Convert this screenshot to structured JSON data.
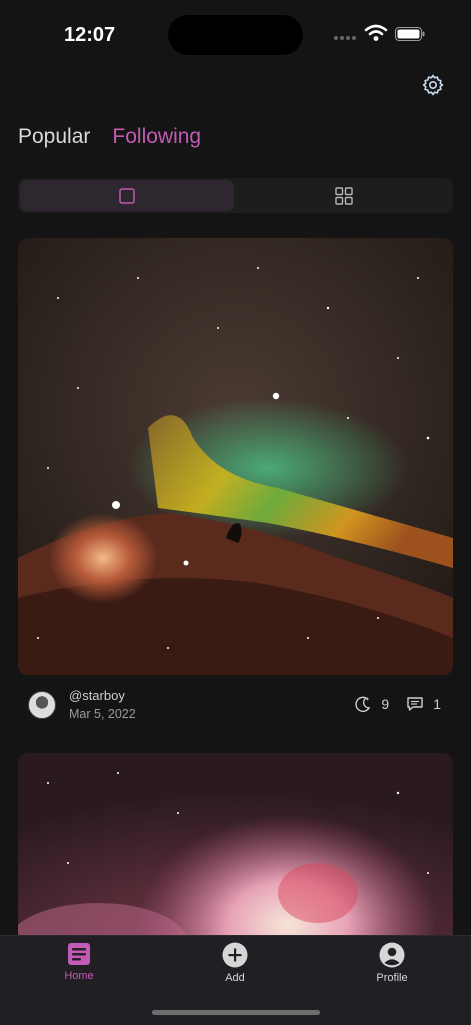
{
  "status_bar": {
    "time": "12:07"
  },
  "header": {
    "settings_icon": "gear-icon"
  },
  "tabs": [
    {
      "label": "Popular",
      "active": false
    },
    {
      "label": "Following",
      "active": true
    }
  ],
  "view_toggle": {
    "options": [
      "single-view-icon",
      "grid-view-icon"
    ],
    "selected": "single-view-icon"
  },
  "feed": {
    "posts": [
      {
        "author": "@starboy",
        "date": "Mar 5, 2022",
        "likes": "9",
        "comments": "1"
      }
    ]
  },
  "bottom_nav": {
    "items": [
      {
        "label": "Home",
        "icon": "home-icon",
        "active": true
      },
      {
        "label": "Add",
        "icon": "add-icon",
        "active": false
      },
      {
        "label": "Profile",
        "icon": "profile-icon",
        "active": false
      }
    ]
  },
  "colors": {
    "accent": "#c25bb4",
    "background": "#141414",
    "nav_background": "#211f23"
  }
}
